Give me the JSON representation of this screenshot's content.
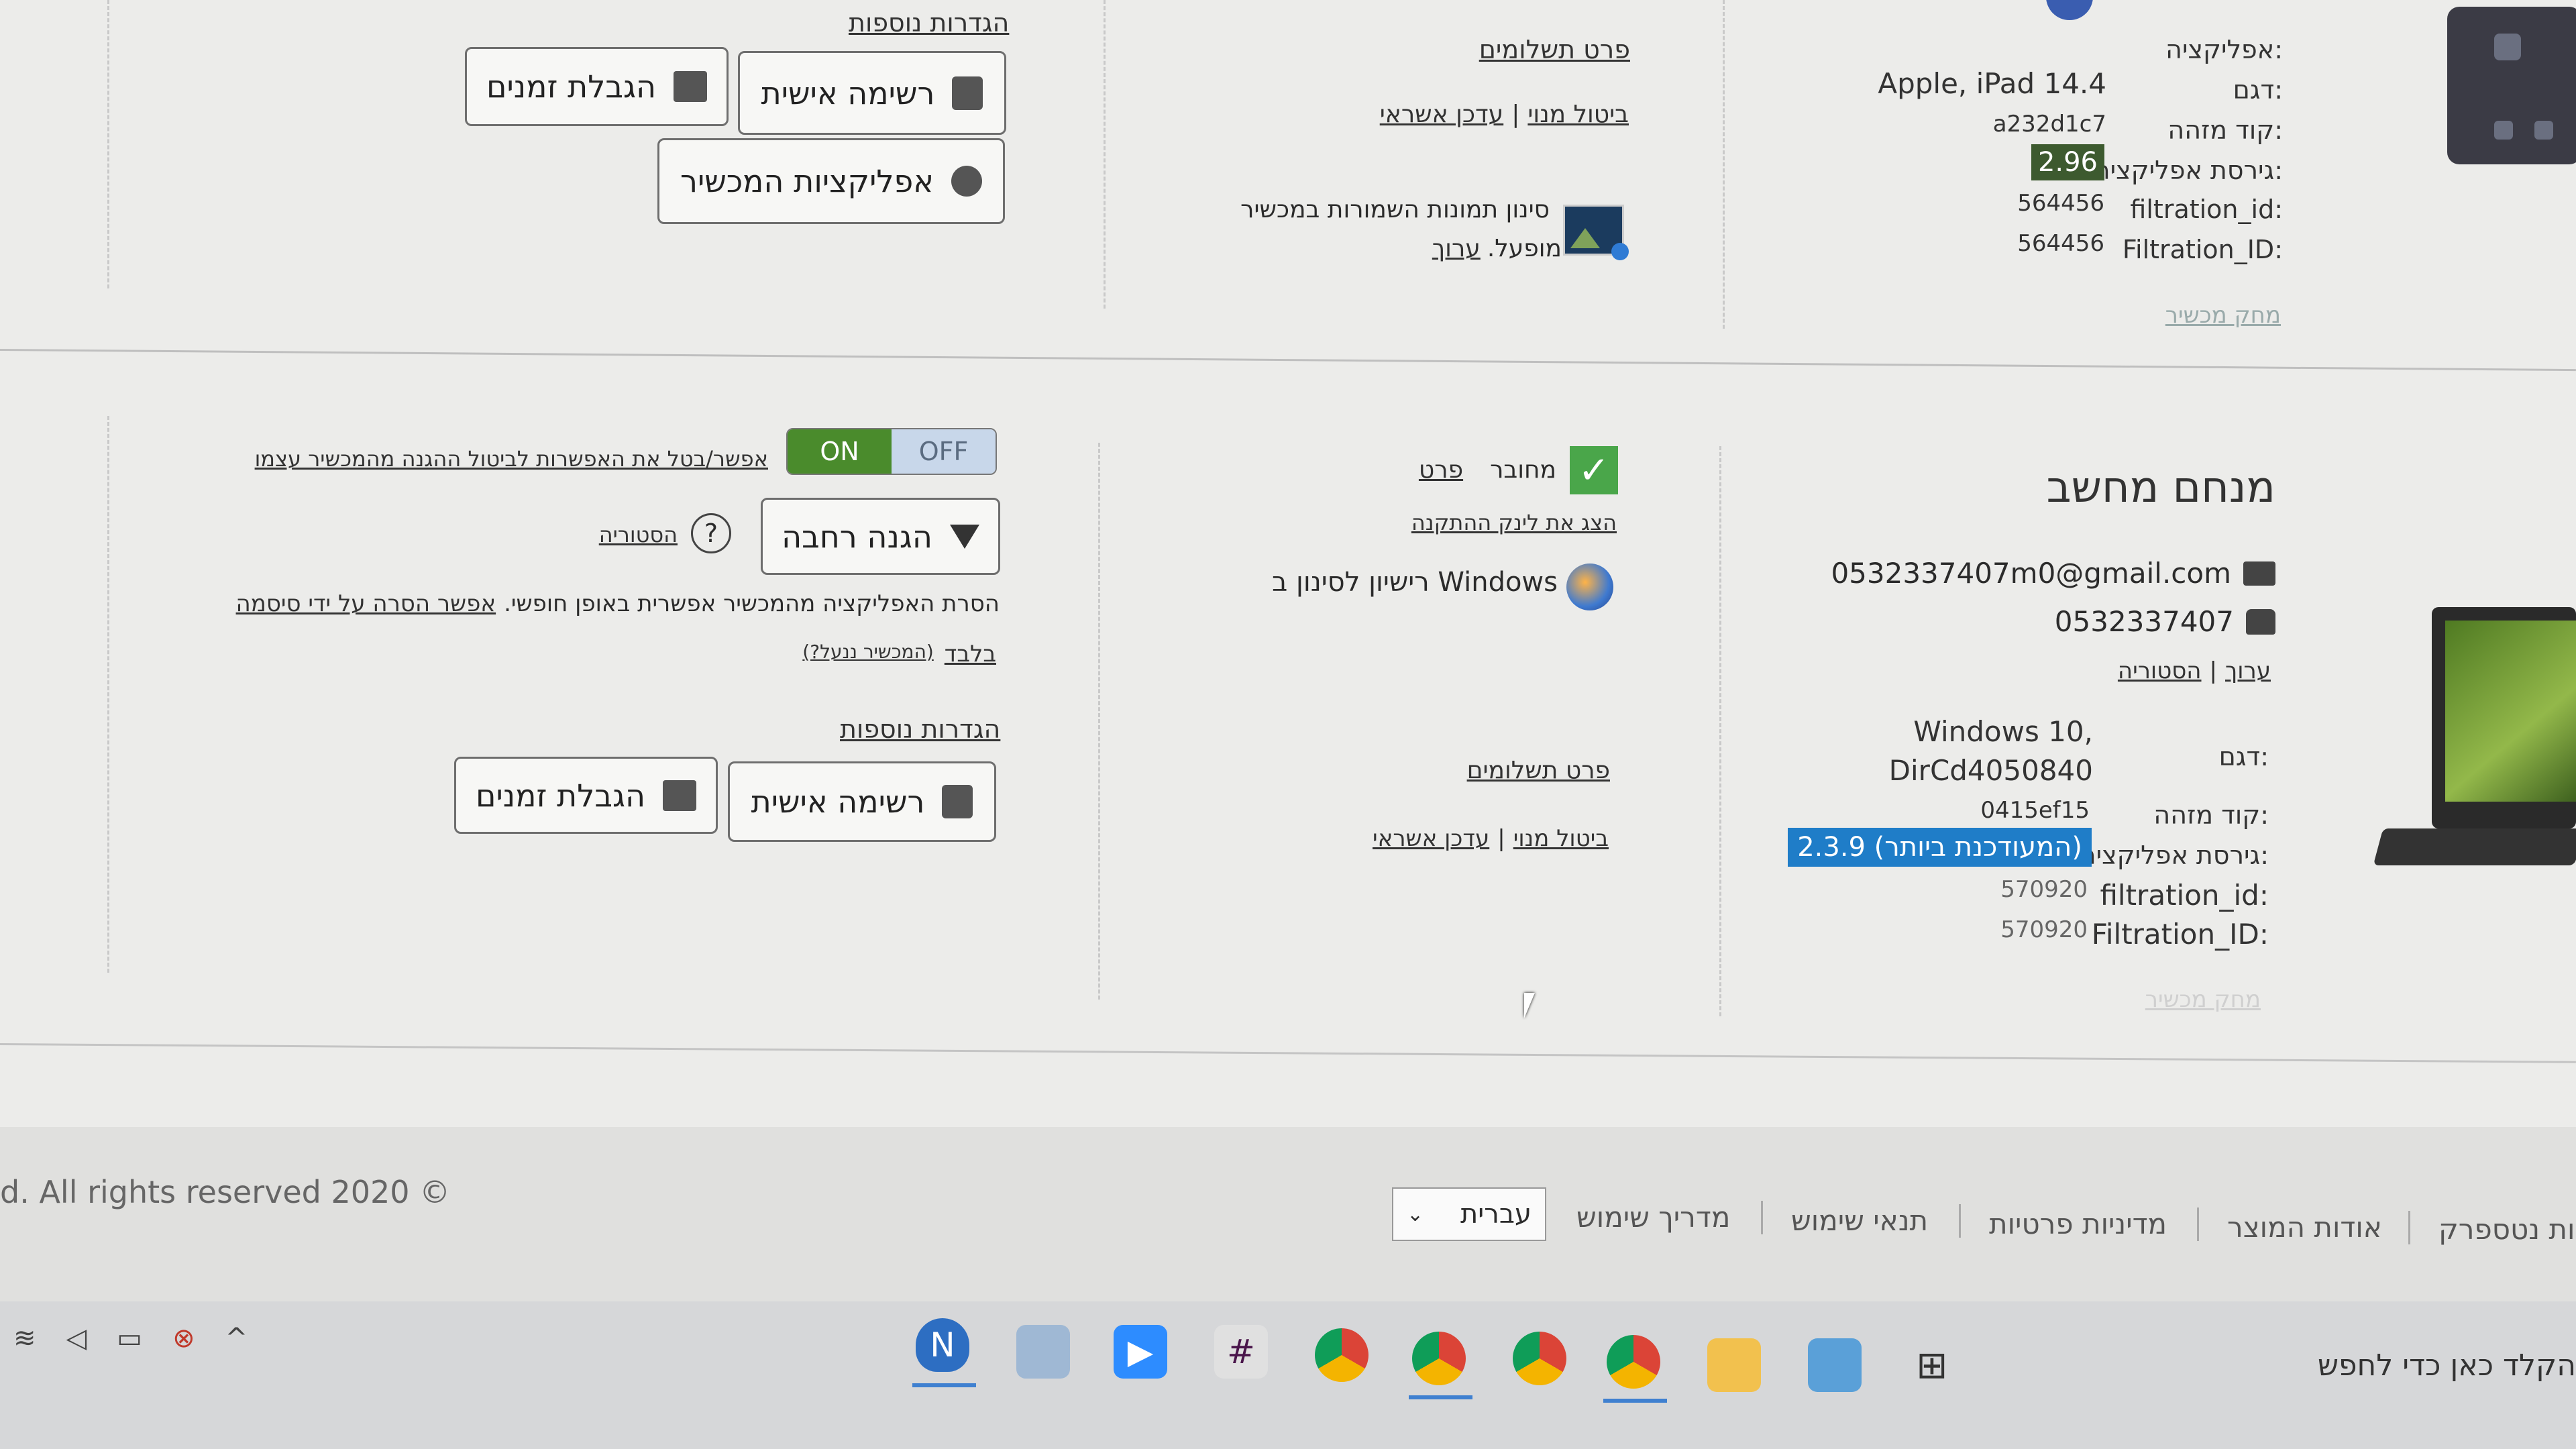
{
  "device1": {
    "app_label": "אפליקציה:",
    "model_label": "דגם:",
    "model_value": "Apple, iPad 14.4",
    "id_label": "קוד מזהה:",
    "id_value": "a232d1c7",
    "version_label": "גירסת אפליקציה:",
    "version_value": "2.96",
    "filtration_id_label": "filtration_id:",
    "filtration_id_value": "564456",
    "Filtration_ID_label": "Filtration_ID:",
    "Filtration_ID_value": "564456",
    "delete_device": "מחק מכשיר",
    "payment_details": "פרט תשלומים",
    "cancel_subscription": "ביטול מנוי",
    "update_credit": "עדכן אשראי",
    "photo_filter_text": "סינון תמונות השמורות במכשיר",
    "photo_filter_status": "מופעל.",
    "photo_filter_edit": "ערוך",
    "more_settings": "הגדרות נוספות",
    "personal_list": "רשימה אישית",
    "time_limit": "הגבלת זמנים",
    "device_apps": "אפליקציות המכשיר"
  },
  "device2": {
    "title": "מנחם מחשב",
    "email": "0532337407m0@gmail.com",
    "phone": "0532337407",
    "edit": "ערוך",
    "history": "הסטוריה",
    "model_label": "דגם:",
    "model_value_line1": "Windows 10,",
    "model_value_line2": "DirCd4050840",
    "id_label": "קוד מזהה:",
    "id_value": "0415ef15",
    "version_label": "גירסת אפליקציה:",
    "version_value": "2.3.9 (המעודכנת ביותר)",
    "filtration_id_label": "filtration_id:",
    "filtration_id_value": "570920",
    "Filtration_ID_label": "Filtration_ID:",
    "Filtration_ID_value": "570920",
    "delete_device": "מחק מכשיר",
    "connected_label": "מחובר",
    "details_link": "פרט",
    "show_install_link": "הצג את לינק ההתקנה",
    "windows_license": "רישיון לסינון ב Windows",
    "payment_details": "פרט תשלומים",
    "cancel_subscription": "ביטול מנוי",
    "update_credit": "עדכן אשראי",
    "toggle_on": "ON",
    "toggle_off": "OFF",
    "toggle_desc": "אפשר/בטל את האפשרות לביטול ההגנה מהמכשיר עצמו",
    "protection_level": "הגנה רחבה",
    "help_symbol": "?",
    "history_link": "הסטוריה",
    "uninstall_text": "הסרת האפליקציה מהמכשיר אפשרית באופן חופשי.",
    "uninstall_link": "אפשר הסרה על ידי סיסמה",
    "only_link": "בלבד",
    "device_locked": "(המכשיר ננעל?)",
    "more_settings": "הגדרות נוספות",
    "personal_list": "רשימה אישית",
    "time_limit": "הגבלת זמנים"
  },
  "footer": {
    "copyright": "d. All rights reserved 2020 ©",
    "language": "עברית",
    "links": [
      "מדריך שימוש",
      "תנאי שימוש",
      "מדיניות פרטיות",
      "אודות המוצר",
      "ות נטספרק"
    ]
  },
  "taskbar": {
    "search_text": "הקלד כאן כדי לחפש",
    "apps": [
      "NetSpark",
      "Photos",
      "Zoom",
      "Slack",
      "Chrome",
      "Chrome profile",
      "Chrome",
      "Chrome profile",
      "File Explorer",
      "Control Panel",
      "Task View"
    ]
  },
  "colors": {
    "accent_blue": "#1f7dc8",
    "version_badge": "#3d5a2f",
    "toggle_on": "#4a8b2c"
  }
}
